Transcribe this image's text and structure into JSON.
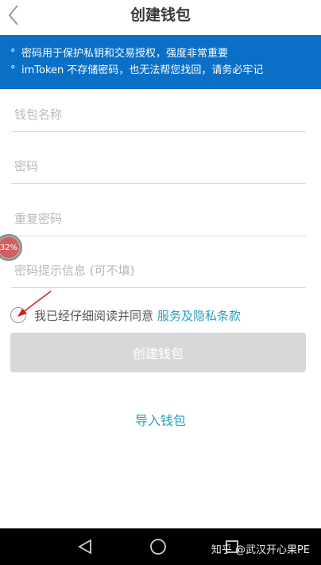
{
  "header": {
    "title": "创建钱包",
    "back_icon": "chevron-left-icon"
  },
  "notice": {
    "bullet": "°",
    "lines": [
      "密码用于保护私钥和交易授权，强度非常重要",
      "imToken 不存储密码，也无法帮您找回，请务必牢记"
    ],
    "background": "#0a6fc6"
  },
  "form": {
    "wallet_name_placeholder": "钱包名称",
    "password_placeholder": "密码",
    "repeat_password_placeholder": "重复密码",
    "hint_placeholder": "密码提示信息 (可不填)",
    "agree_text": "我已经仔细阅读并同意",
    "terms_link": "服务及隐私条款",
    "create_button": "创建钱包",
    "import_link": "导入钱包"
  },
  "overlay": {
    "badge_text": "32%"
  },
  "navbar": {
    "icons": [
      "back-triangle-icon",
      "home-circle-icon",
      "recents-square-icon"
    ],
    "watermark": "知乎 @武汉开心果PE"
  },
  "colors": {
    "accent": "#2a9fc0",
    "button_disabled": "#d8d8d8",
    "notice": "#0a6fc6"
  }
}
